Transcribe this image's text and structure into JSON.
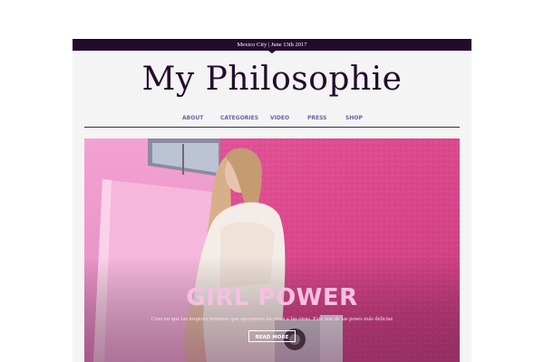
{
  "header": {
    "topbar_text": "Mexico City | June 13th 2017",
    "site_title": "My Philosophie"
  },
  "nav": {
    "items": [
      {
        "label": "ABOUT"
      },
      {
        "label": "CATEGORIES"
      },
      {
        "label": "VIDEO"
      },
      {
        "label": "PRESS"
      },
      {
        "label": "SHOP"
      }
    ]
  },
  "hero": {
    "title": "GIRL POWER",
    "subtitle": "Creo en que las mujeres tenemos que apoyarnos las unas a las otras. Este test de las poses más delicias",
    "button_label": "READ MORE"
  },
  "colors": {
    "topbar": "#230b2e",
    "title": "#230b2e",
    "nav": "#6b63a3",
    "hero_title": "#f6bfe1",
    "wall": "#d9468b"
  }
}
